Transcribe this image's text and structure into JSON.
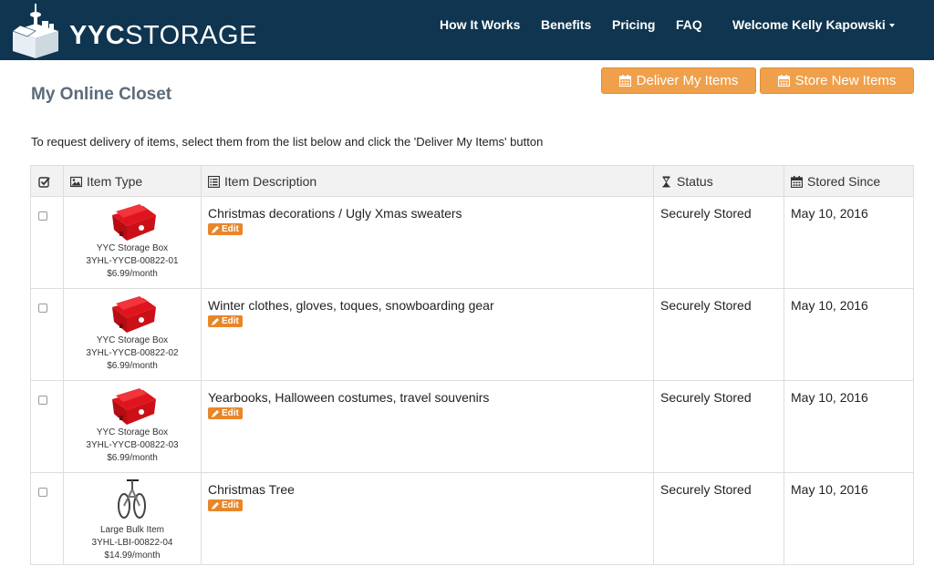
{
  "brand": {
    "name_bold": "YYC",
    "name_light": "STORAGE"
  },
  "nav": {
    "how_it_works": "How It Works",
    "benefits": "Benefits",
    "pricing": "Pricing",
    "faq": "FAQ",
    "user_menu": "Welcome Kelly Kapowski"
  },
  "page": {
    "title": "My Online Closet",
    "deliver_button": "Deliver My Items",
    "store_button": "Store New Items",
    "instructions": "To request delivery of items, select them from the list below and click the 'Deliver My Items' button"
  },
  "table": {
    "headers": {
      "item_type": "Item Type",
      "item_description": "Item Description",
      "status": "Status",
      "stored_since": "Stored Since"
    },
    "edit_label": "Edit",
    "rows": [
      {
        "type": "YYC Storage Box",
        "code": "3YHL-YYCB-00822-01",
        "price": "$6.99/month",
        "description": "Christmas decorations / Ugly Xmas sweaters",
        "status": "Securely Stored",
        "stored_since": "May 10, 2016",
        "image": "red-storage-box"
      },
      {
        "type": "YYC Storage Box",
        "code": "3YHL-YYCB-00822-02",
        "price": "$6.99/month",
        "description": "Winter clothes, gloves, toques, snowboarding gear",
        "status": "Securely Stored",
        "stored_since": "May 10, 2016",
        "image": "red-storage-box"
      },
      {
        "type": "YYC Storage Box",
        "code": "3YHL-YYCB-00822-03",
        "price": "$6.99/month",
        "description": "Yearbooks, Halloween costumes, travel souvenirs",
        "status": "Securely Stored",
        "stored_since": "May 10, 2016",
        "image": "red-storage-box"
      },
      {
        "type": "Large Bulk Item",
        "code": "3YHL-LBI-00822-04",
        "price": "$14.99/month",
        "description": "Christmas Tree",
        "status": "Securely Stored",
        "stored_since": "May 10, 2016",
        "image": "bicycle"
      }
    ]
  },
  "colors": {
    "navbar": "#0f3550",
    "accent_button": "#f0a04b",
    "edit_badge": "#e8862a",
    "title_text": "#5c6b7a"
  }
}
